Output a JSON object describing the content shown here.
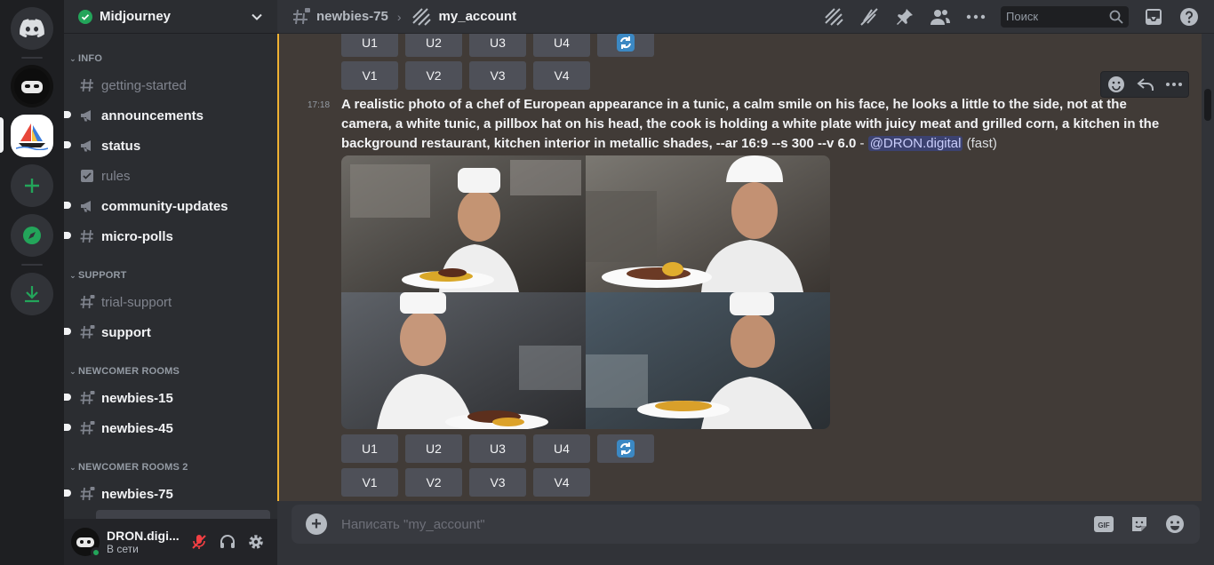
{
  "server_rail": {
    "items": [
      "discord-home",
      "midjourney-bot-server",
      "midjourney-server",
      "add-server",
      "explore",
      "download-apps"
    ]
  },
  "sidebar": {
    "guild_name": "Midjourney",
    "categories": [
      {
        "name": "INFO",
        "channels": [
          {
            "label": "getting-started",
            "icon": "hash",
            "unread": false
          },
          {
            "label": "announcements",
            "icon": "megaphone",
            "unread": true
          },
          {
            "label": "status",
            "icon": "megaphone",
            "unread": true
          },
          {
            "label": "rules",
            "icon": "rules",
            "unread": false
          },
          {
            "label": "community-updates",
            "icon": "megaphone",
            "unread": true
          },
          {
            "label": "micro-polls",
            "icon": "hash",
            "unread": true
          }
        ]
      },
      {
        "name": "SUPPORT",
        "channels": [
          {
            "label": "trial-support",
            "icon": "hash-lock",
            "unread": false
          },
          {
            "label": "support",
            "icon": "hash-lock",
            "unread": true
          }
        ]
      },
      {
        "name": "NEWCOMER ROOMS",
        "channels": [
          {
            "label": "newbies-15",
            "icon": "hash-lock",
            "unread": true
          },
          {
            "label": "newbies-45",
            "icon": "hash-lock",
            "unread": true
          }
        ]
      },
      {
        "name": "NEWCOMER ROOMS 2",
        "channels": [
          {
            "label": "newbies-75",
            "icon": "hash-lock",
            "unread": true
          }
        ]
      }
    ],
    "user": {
      "name": "DRON.digi...",
      "status": "В сети"
    }
  },
  "header": {
    "parent_channel": "newbies-75",
    "thread": "my_account",
    "search_placeholder": "Поиск"
  },
  "messages": {
    "top_buttons_upscale": [
      "U1",
      "U2",
      "U3",
      "U4"
    ],
    "top_buttons_variation": [
      "V1",
      "V2",
      "V3",
      "V4"
    ],
    "timestamp": "17:18",
    "prompt_text": "A realistic photo of a chef of European appearance in a tunic, a calm smile on his face, he looks a little to the side, not at the camera, a white tunic, a pillbox hat on his head, the cook is holding a white plate with juicy meat and grilled corn, a kitchen in the background restaurant, kitchen interior in metallic shades, --ar 16:9 --s 300 --v 6.0",
    "dash": " - ",
    "mention": "@DRON.digital",
    "speed": "(fast)",
    "upscale_buttons": [
      "U1",
      "U2",
      "U3",
      "U4"
    ],
    "variation_buttons": [
      "V1",
      "V2",
      "V3",
      "V4"
    ]
  },
  "composer": {
    "placeholder": "Написать \"my_account\"",
    "gif_label": "GIF"
  },
  "colors": {
    "accent_green": "#23a55a",
    "unread_bar": "#f0b232",
    "mention_bg": "#3c4270"
  }
}
